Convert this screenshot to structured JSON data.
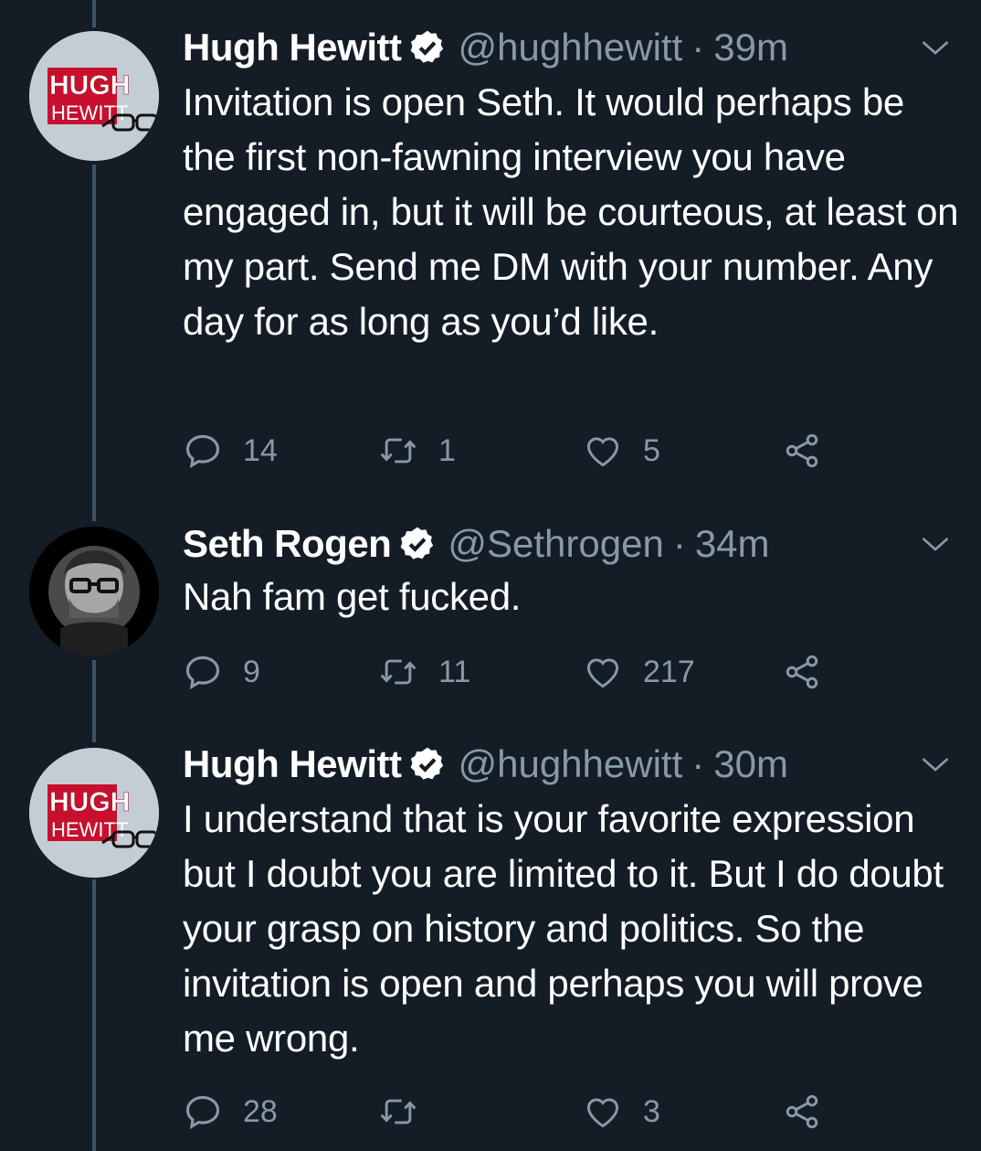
{
  "tweets": [
    {
      "name": "Hugh Hewitt",
      "handle": "@hughhewitt",
      "separator": "·",
      "time": "39m",
      "text": "Invitation is open Seth. It would perhaps be the first non-fawning interview you have engaged in, but it will be courteous, at least on my part. Send me DM with your number. Any day for as long as you’d like.",
      "replies": "14",
      "retweets": "1",
      "likes": "5",
      "avatar_text": [
        "HUGH",
        "HEWITT"
      ]
    },
    {
      "name": "Seth Rogen",
      "handle": "@Sethrogen",
      "separator": "·",
      "time": "34m",
      "text": "Nah fam get fucked.",
      "replies": "9",
      "retweets": "11",
      "likes": "217"
    },
    {
      "name": "Hugh Hewitt",
      "handle": "@hughhewitt",
      "separator": "·",
      "time": "30m",
      "text": "I understand that is your favorite expression but I doubt you are limited to it. But I do doubt your grasp on history and politics. So the invitation is open and perhaps you will prove me wrong.",
      "replies": "28",
      "retweets": "",
      "likes": "3",
      "avatar_text": [
        "HUGH",
        "HEWITT"
      ]
    }
  ],
  "icons": {
    "reply": "reply-icon",
    "retweet": "retweet-icon",
    "like": "heart-icon",
    "share": "share-icon",
    "verified": "verified-badge-icon",
    "menu": "chevron-down-icon"
  },
  "colors": {
    "background": "#141d26",
    "secondary_text": "#8899a6",
    "thread_line": "#3d5466",
    "hewitt_red": "#c8102e"
  }
}
